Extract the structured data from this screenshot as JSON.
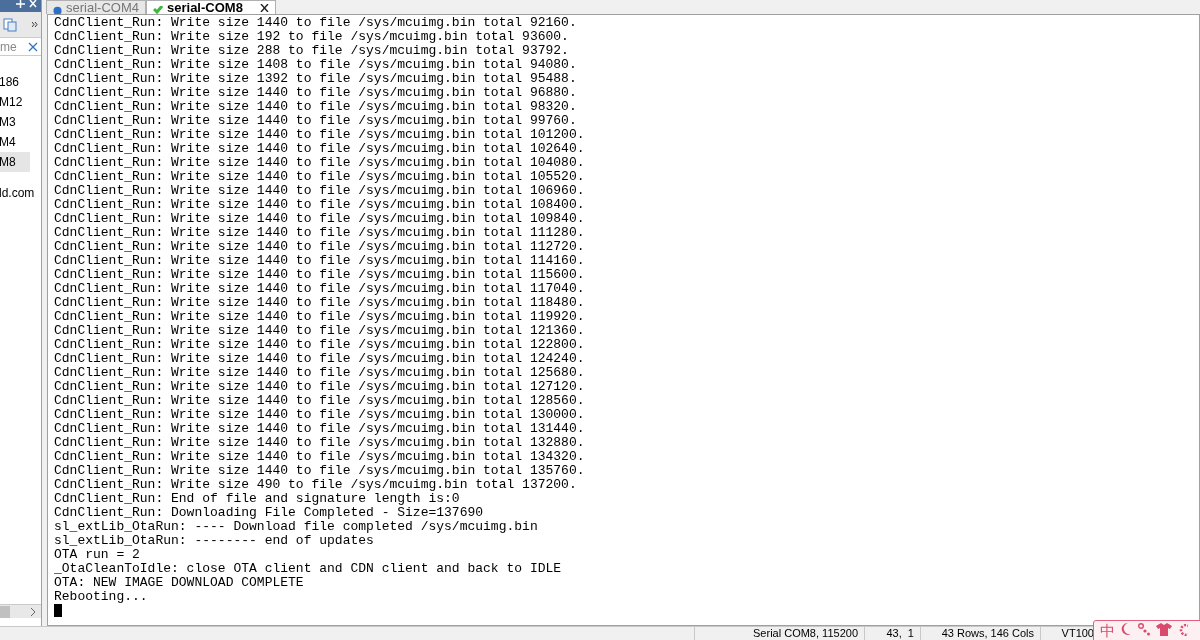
{
  "side_panel": {
    "search": {
      "value": "me"
    },
    "items": [
      {
        "label": "186",
        "selected": false
      },
      {
        "label": "M12",
        "selected": false
      },
      {
        "label": "M3",
        "selected": false
      },
      {
        "label": "M4",
        "selected": false
      },
      {
        "label": "M8",
        "selected": true
      }
    ],
    "link": "ld.com"
  },
  "tabs": [
    {
      "label": "serial-COM4",
      "selected": false,
      "closable": false
    },
    {
      "label": "serial-COM8",
      "selected": true,
      "closable": true
    }
  ],
  "terminal": {
    "lines": [
      "CdnClient_Run: Write size 1440 to file /sys/mcuimg.bin total 92160.",
      "CdnClient_Run: Write size 192 to file /sys/mcuimg.bin total 93600.",
      "CdnClient_Run: Write size 288 to file /sys/mcuimg.bin total 93792.",
      "CdnClient_Run: Write size 1408 to file /sys/mcuimg.bin total 94080.",
      "CdnClient_Run: Write size 1392 to file /sys/mcuimg.bin total 95488.",
      "CdnClient_Run: Write size 1440 to file /sys/mcuimg.bin total 96880.",
      "CdnClient_Run: Write size 1440 to file /sys/mcuimg.bin total 98320.",
      "CdnClient_Run: Write size 1440 to file /sys/mcuimg.bin total 99760.",
      "CdnClient_Run: Write size 1440 to file /sys/mcuimg.bin total 101200.",
      "CdnClient_Run: Write size 1440 to file /sys/mcuimg.bin total 102640.",
      "CdnClient_Run: Write size 1440 to file /sys/mcuimg.bin total 104080.",
      "CdnClient_Run: Write size 1440 to file /sys/mcuimg.bin total 105520.",
      "CdnClient_Run: Write size 1440 to file /sys/mcuimg.bin total 106960.",
      "CdnClient_Run: Write size 1440 to file /sys/mcuimg.bin total 108400.",
      "CdnClient_Run: Write size 1440 to file /sys/mcuimg.bin total 109840.",
      "CdnClient_Run: Write size 1440 to file /sys/mcuimg.bin total 111280.",
      "CdnClient_Run: Write size 1440 to file /sys/mcuimg.bin total 112720.",
      "CdnClient_Run: Write size 1440 to file /sys/mcuimg.bin total 114160.",
      "CdnClient_Run: Write size 1440 to file /sys/mcuimg.bin total 115600.",
      "CdnClient_Run: Write size 1440 to file /sys/mcuimg.bin total 117040.",
      "CdnClient_Run: Write size 1440 to file /sys/mcuimg.bin total 118480.",
      "CdnClient_Run: Write size 1440 to file /sys/mcuimg.bin total 119920.",
      "CdnClient_Run: Write size 1440 to file /sys/mcuimg.bin total 121360.",
      "CdnClient_Run: Write size 1440 to file /sys/mcuimg.bin total 122800.",
      "CdnClient_Run: Write size 1440 to file /sys/mcuimg.bin total 124240.",
      "CdnClient_Run: Write size 1440 to file /sys/mcuimg.bin total 125680.",
      "CdnClient_Run: Write size 1440 to file /sys/mcuimg.bin total 127120.",
      "CdnClient_Run: Write size 1440 to file /sys/mcuimg.bin total 128560.",
      "CdnClient_Run: Write size 1440 to file /sys/mcuimg.bin total 130000.",
      "CdnClient_Run: Write size 1440 to file /sys/mcuimg.bin total 131440.",
      "CdnClient_Run: Write size 1440 to file /sys/mcuimg.bin total 132880.",
      "CdnClient_Run: Write size 1440 to file /sys/mcuimg.bin total 134320.",
      "CdnClient_Run: Write size 1440 to file /sys/mcuimg.bin total 135760.",
      "CdnClient_Run: Write size 490 to file /sys/mcuimg.bin total 137200.",
      "CdnClient_Run: End of file and signature length is:0",
      "CdnClient_Run: Downloading File Completed - Size=137690",
      "sl_extLib_OtaRun: ---- Download file completed /sys/mcuimg.bin",
      "sl_extLib_OtaRun: -------- end of updates",
      "OTA run = 2",
      "_OtaCleanToIdle: close OTA client and CDN client and back to IDLE",
      "OTA: NEW IMAGE DOWNLOAD COMPLETE",
      "Rebooting..."
    ]
  },
  "status_bar": [
    "Serial COM8, 115200",
    "43,  1",
    "43 Rows, 146 Cols",
    "VT100"
  ],
  "ime_bar": {
    "label": "中"
  }
}
